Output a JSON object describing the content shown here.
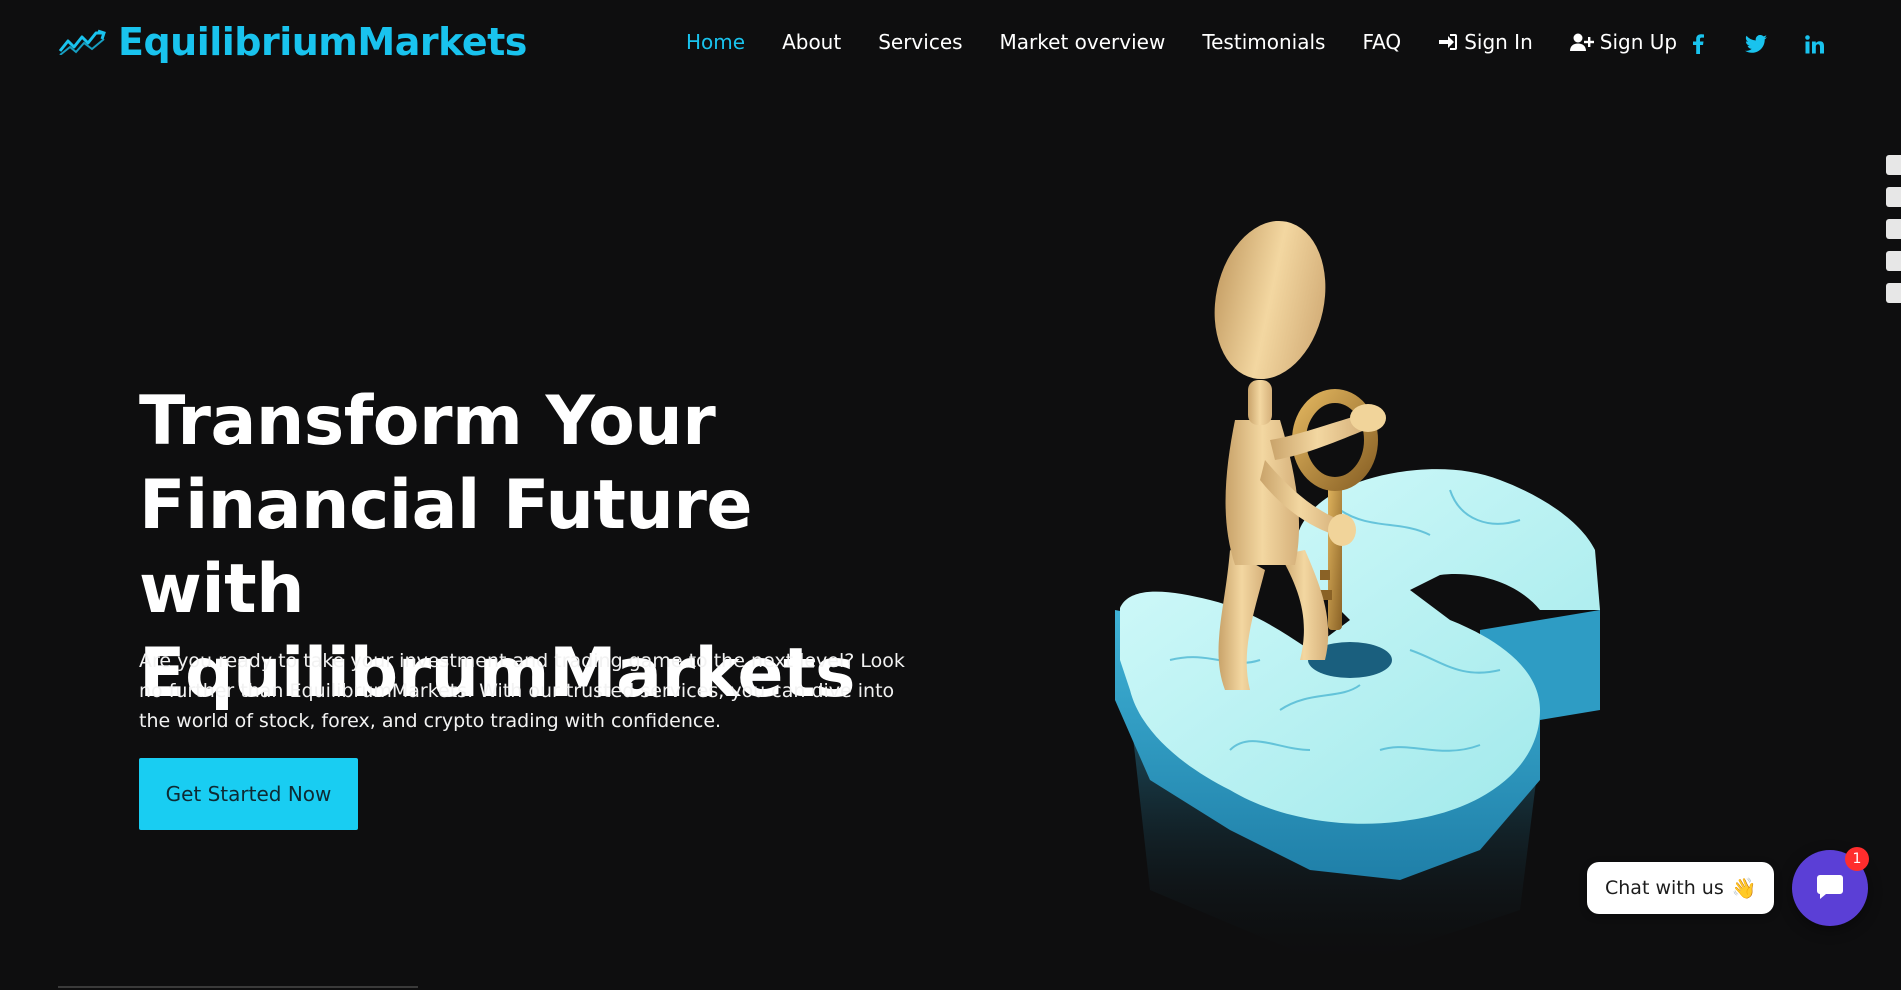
{
  "brand": {
    "name": "EquilibriumMarkets",
    "icon": "chart-trend-icon",
    "color": "#19c3ee"
  },
  "nav": {
    "items": [
      {
        "label": "Home",
        "active": true
      },
      {
        "label": "About"
      },
      {
        "label": "Services"
      },
      {
        "label": "Market overview"
      },
      {
        "label": "Testimonials"
      },
      {
        "label": "FAQ"
      },
      {
        "label": "Sign In",
        "icon": "sign-in-icon"
      },
      {
        "label": "Sign Up",
        "icon": "user-plus-icon"
      }
    ],
    "social": [
      "facebook-icon",
      "twitter-icon",
      "linkedin-icon"
    ],
    "accent": "#19c3ee"
  },
  "hero": {
    "title_lines": [
      "Transform Your",
      "Financial Future with",
      "EquilibrumMarkets"
    ],
    "text": "Are you ready to take your investment and trading game to the next level? Look no further than EquilibrumMarkets. With our trusted services, you can dive into the world of stock, forex, and crypto trading with confidence.",
    "cta_label": "Get Started Now",
    "cta_color": "#19cdf2"
  },
  "chat": {
    "label": "Chat with us",
    "emoji": "👋",
    "badge": "1",
    "button_color": "#5b3fd6"
  }
}
